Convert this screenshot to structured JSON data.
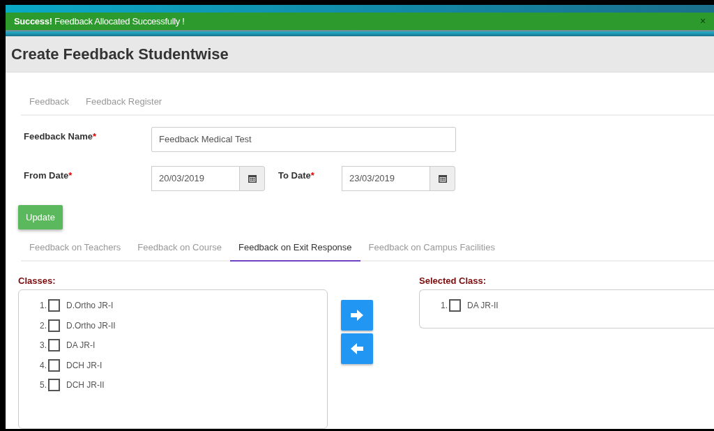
{
  "alert": {
    "message": "**Success!** Feedback Allocated Successfully !",
    "close": "×"
  },
  "page_title": "Create Feedback Studentwise",
  "top_tabs": [
    {
      "label": "Feedback",
      "selected": false
    },
    {
      "label": "Feedback Register",
      "selected": false
    }
  ],
  "form": {
    "feedback_name": {
      "label": "Feedback Name",
      "required_mark": "*",
      "value": "Feedback Medical Test"
    },
    "from_date": {
      "label": "From Date",
      "required_mark": "*",
      "value": "20/03/2019"
    },
    "to_date": {
      "label": "To Date",
      "required_mark": "*",
      "value": "23/03/2019"
    },
    "update_button": "Update"
  },
  "feedback_tabs": [
    {
      "label": "Feedback on Teachers",
      "selected": false
    },
    {
      "label": "Feedback on Course",
      "selected": false
    },
    {
      "label": "Feedback on Exit Response",
      "selected": true
    },
    {
      "label": "Feedback on Campus Facilities",
      "selected": false
    }
  ],
  "classes": {
    "label": "Classes:",
    "items": [
      {
        "number": "1.",
        "name": "D.Ortho JR-I",
        "checked": false
      },
      {
        "number": "2.",
        "name": "D.Ortho JR-II",
        "checked": false
      },
      {
        "number": "3.",
        "name": "DA JR-I",
        "checked": false
      },
      {
        "number": "4.",
        "name": "DCH JR-I",
        "checked": false
      },
      {
        "number": "5.",
        "name": "DCH JR-II",
        "checked": false
      }
    ]
  },
  "selected_class": {
    "label": "Selected Class:",
    "items": [
      {
        "number": "1.",
        "name": "DA JR-II",
        "checked": false
      }
    ]
  }
}
